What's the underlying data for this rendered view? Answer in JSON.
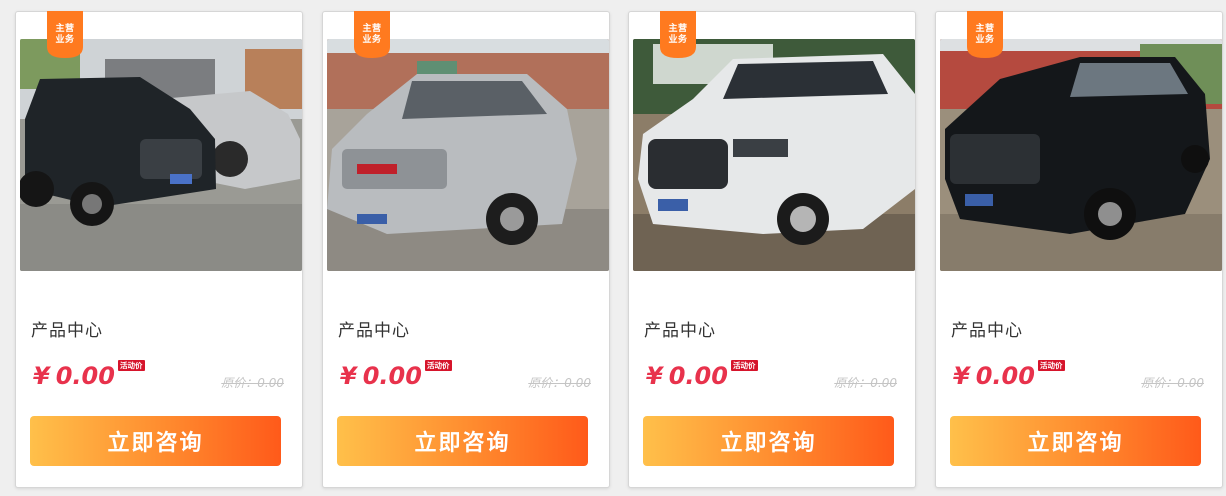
{
  "theme": {
    "accent": "#e8324c",
    "button_gradient": [
      "#ffc04a",
      "#ff5a1a"
    ],
    "badge_color": "#ff7a1f"
  },
  "products": [
    {
      "badge": [
        "主营",
        "业务"
      ],
      "image": "black-pickup-truck-photo",
      "title": "产品中心",
      "currency": "¥",
      "price": "0.00",
      "promo_tag": "活动价",
      "orig_price": "原价：0.00",
      "button": "立即咨询"
    },
    {
      "badge": [
        "主营",
        "业务"
      ],
      "image": "silver-pickup-truck-photo",
      "title": "产品中心",
      "currency": "¥",
      "price": "0.00",
      "promo_tag": "活动价",
      "orig_price": "原价：0.00",
      "button": "立即咨询"
    },
    {
      "badge": [
        "主营",
        "业务"
      ],
      "image": "white-pickup-truck-photo",
      "title": "产品中心",
      "currency": "¥",
      "price": "0.00",
      "promo_tag": "活动价",
      "orig_price": "原价：0.00",
      "button": "立即咨询"
    },
    {
      "badge": [
        "主营",
        "业务"
      ],
      "image": "black-pickup-truck-photo",
      "title": "产品中心",
      "currency": "¥",
      "price": "0.00",
      "promo_tag": "活动价",
      "orig_price": "原价：0.00",
      "button": "立即咨询"
    }
  ]
}
